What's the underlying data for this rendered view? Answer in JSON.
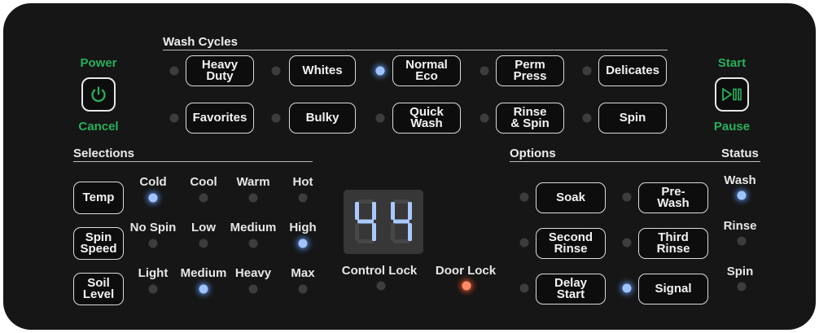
{
  "power": {
    "top_label": "Power",
    "bottom_label": "Cancel"
  },
  "start": {
    "top_label": "Start",
    "bottom_label": "Pause"
  },
  "wash_cycles": {
    "header": "Wash Cycles",
    "buttons": [
      {
        "label": "Heavy\nDuty",
        "led": "off"
      },
      {
        "label": "Whites",
        "led": "off"
      },
      {
        "label": "Normal\nEco",
        "led": "on"
      },
      {
        "label": "Perm\nPress",
        "led": "off"
      },
      {
        "label": "Delicates",
        "led": "off"
      },
      {
        "label": "Favorites",
        "led": "off"
      },
      {
        "label": "Bulky",
        "led": "off"
      },
      {
        "label": "Quick\nWash",
        "led": "off"
      },
      {
        "label": "Rinse\n& Spin",
        "led": "off"
      },
      {
        "label": "Spin",
        "led": "off"
      }
    ]
  },
  "selections": {
    "header": "Selections",
    "temp": {
      "button": "Temp",
      "options": [
        "Cold",
        "Cool",
        "Warm",
        "Hot"
      ],
      "selected": "Cold"
    },
    "spin_speed": {
      "button": "Spin\nSpeed",
      "options": [
        "No Spin",
        "Low",
        "Medium",
        "High"
      ],
      "selected": "High"
    },
    "soil_level": {
      "button": "Soil\nLevel",
      "options": [
        "Light",
        "Medium",
        "Heavy",
        "Max"
      ],
      "selected": "Medium"
    }
  },
  "display": {
    "value": "44",
    "color": "#a9c9ff"
  },
  "locks": {
    "control_lock": "Control Lock",
    "control_lock_led": "off",
    "door_lock": "Door Lock",
    "door_lock_led": "on"
  },
  "options": {
    "header": "Options",
    "buttons": [
      {
        "label": "Soak",
        "led": "off"
      },
      {
        "label": "Pre-\nWash",
        "led": "off"
      },
      {
        "label": "Second\nRinse",
        "led": "off"
      },
      {
        "label": "Third\nRinse",
        "led": "off"
      },
      {
        "label": "Delay\nStart",
        "led": "off"
      },
      {
        "label": "Signal",
        "led": "on"
      }
    ]
  },
  "status": {
    "header": "Status",
    "items": [
      {
        "label": "Wash",
        "led": "on"
      },
      {
        "label": "Rinse",
        "led": "off"
      },
      {
        "label": "Spin",
        "led": "off"
      }
    ]
  },
  "colors": {
    "panel": "#161616",
    "accent_green": "#27b05a",
    "led_blue": "#9ec3ff",
    "led_red": "#ff8a66",
    "led_off": "#3d3d3d"
  }
}
